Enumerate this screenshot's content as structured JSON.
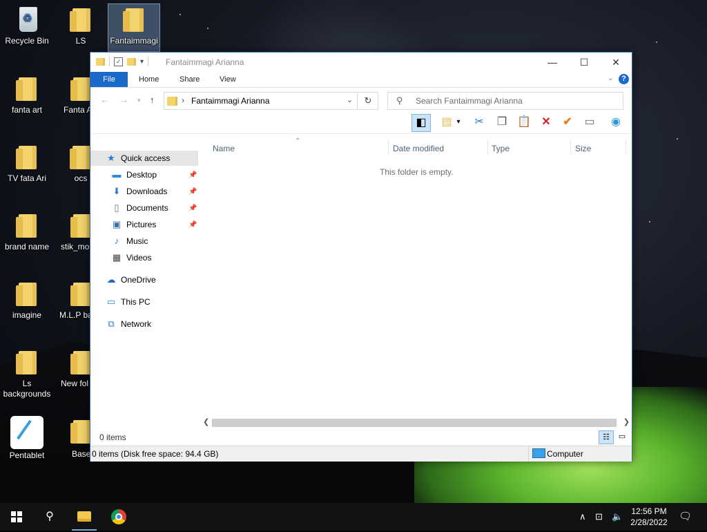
{
  "desktop": {
    "icons": [
      {
        "label": "Recycle Bin"
      },
      {
        "label": "LS"
      },
      {
        "label": "Fantaimmagi"
      },
      {
        "label": "fanta art"
      },
      {
        "label": "Fanta A"
      },
      {
        "label": "TV  fata Ari"
      },
      {
        "label": "ocs"
      },
      {
        "label": "brand name"
      },
      {
        "label": "stik_mo"
      },
      {
        "label": "imagine"
      },
      {
        "label": "M.L.P ba"
      },
      {
        "label": "Ls backgrounds"
      },
      {
        "label": "New fol"
      },
      {
        "label": "Pentablet"
      },
      {
        "label": "Base"
      }
    ]
  },
  "window": {
    "title": "Fantaimmagi Arianna",
    "controls": {
      "minimize": "—",
      "maximize": "☐",
      "close": "✕"
    },
    "ribbon_tabs": [
      {
        "label": "File"
      },
      {
        "label": "Home"
      },
      {
        "label": "Share"
      },
      {
        "label": "View"
      }
    ],
    "help": "?",
    "address": {
      "path": "Fantaimmagi Arianna"
    },
    "search": {
      "placeholder": "Search Fantaimmagi Arianna"
    },
    "nav_pane": [
      {
        "label": "Quick access",
        "icon": "star-icon"
      },
      {
        "label": "Desktop",
        "icon": "desktop-icon",
        "pinned": true
      },
      {
        "label": "Downloads",
        "icon": "download-icon",
        "pinned": true
      },
      {
        "label": "Documents",
        "icon": "documents-icon",
        "pinned": true
      },
      {
        "label": "Pictures",
        "icon": "pictures-icon",
        "pinned": true
      },
      {
        "label": "Music",
        "icon": "music-icon"
      },
      {
        "label": "Videos",
        "icon": "videos-icon"
      },
      {
        "label": "OneDrive",
        "icon": "cloud-icon"
      },
      {
        "label": "This PC",
        "icon": "computer-icon"
      },
      {
        "label": "Network",
        "icon": "network-icon"
      }
    ],
    "columns": [
      {
        "label": "Name"
      },
      {
        "label": "Date modified"
      },
      {
        "label": "Type"
      },
      {
        "label": "Size"
      }
    ],
    "empty_message": "This folder is empty.",
    "status_count": "0 items",
    "info_bar": "0 items (Disk free space: 94.4 GB)",
    "info_location": "Computer"
  },
  "taskbar": {
    "time": "12:56 PM",
    "date": "2/28/2022"
  },
  "colors": {
    "accent": "#1b6ac9",
    "selection": "#cce4f7"
  }
}
